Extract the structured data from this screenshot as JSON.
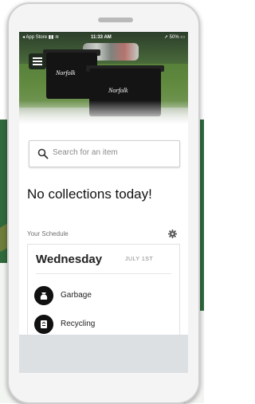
{
  "status_bar": {
    "carrier": "App Store",
    "time": "11:33 AM",
    "battery": "50%"
  },
  "hero": {
    "bin_logo_1": "Norfolk",
    "bin_logo_2": "Norfolk"
  },
  "search": {
    "placeholder": "Search for an item"
  },
  "main": {
    "status_message": "No collections today!"
  },
  "schedule": {
    "label": "Your Schedule",
    "day": "Wednesday",
    "date": "JULY 1ST",
    "items": [
      {
        "label": "Garbage",
        "icon": "garbage-bag-icon"
      },
      {
        "label": "Recycling",
        "icon": "recycling-bin-icon"
      }
    ]
  },
  "colors": {
    "brand_green": "#2f6a3c",
    "icon_black": "#111111"
  }
}
